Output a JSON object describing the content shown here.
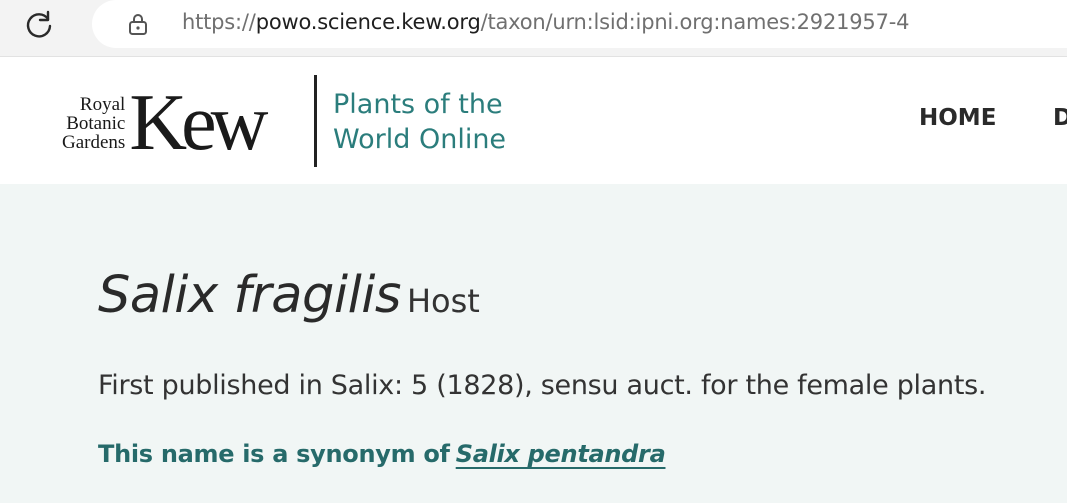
{
  "browser": {
    "url_prefix": "https://",
    "url_domain": "powo.science.kew.org",
    "url_path": "/taxon/urn:lsid:ipni.org:names:2921957-4",
    "icons": [
      "reload-icon",
      "lock-icon"
    ]
  },
  "header": {
    "logo_small_line1": "Royal",
    "logo_small_line2": "Botanic",
    "logo_small_line3": "Gardens",
    "logo_big": "Kew",
    "site_name_line1": "Plants of the",
    "site_name_line2": "World Online",
    "nav": {
      "home": "HOME",
      "next_partial": "D"
    }
  },
  "taxon": {
    "name": "Salix fragilis",
    "rank": "Host",
    "published": "First published in Salix: 5 (1828), sensu auct. for the female plants.",
    "synonym_prefix": "This name is a synonym of",
    "synonym_name": "Salix pentandra"
  },
  "colors": {
    "accent": "#2b7d7c",
    "synonym": "#266a6a",
    "page_bg": "#f1f6f5"
  }
}
